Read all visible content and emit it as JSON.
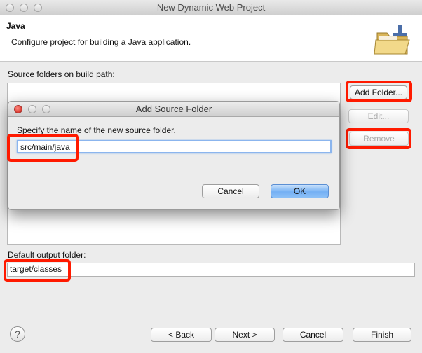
{
  "window": {
    "title": "New Dynamic Web Project"
  },
  "header": {
    "title": "Java",
    "description": "Configure project for building a Java application.",
    "icon": "folder-icon"
  },
  "source_section": {
    "label": "Source folders on build path:",
    "buttons": {
      "add_folder": "Add Folder...",
      "edit": "Edit...",
      "remove": "Remove"
    }
  },
  "output_section": {
    "label": "Default output folder:",
    "value": "target/classes"
  },
  "footer": {
    "help_symbol": "?",
    "back": "< Back",
    "next": "Next >",
    "cancel": "Cancel",
    "finish": "Finish"
  },
  "dialog": {
    "title": "Add Source Folder",
    "prompt": "Specify the name of the new source folder.",
    "input_value": "src/main/java",
    "cancel": "Cancel",
    "ok": "OK"
  },
  "colors": {
    "highlight": "#ff1a00",
    "primary_button": "#74b0f4",
    "input_focus": "#8bb5ee"
  }
}
